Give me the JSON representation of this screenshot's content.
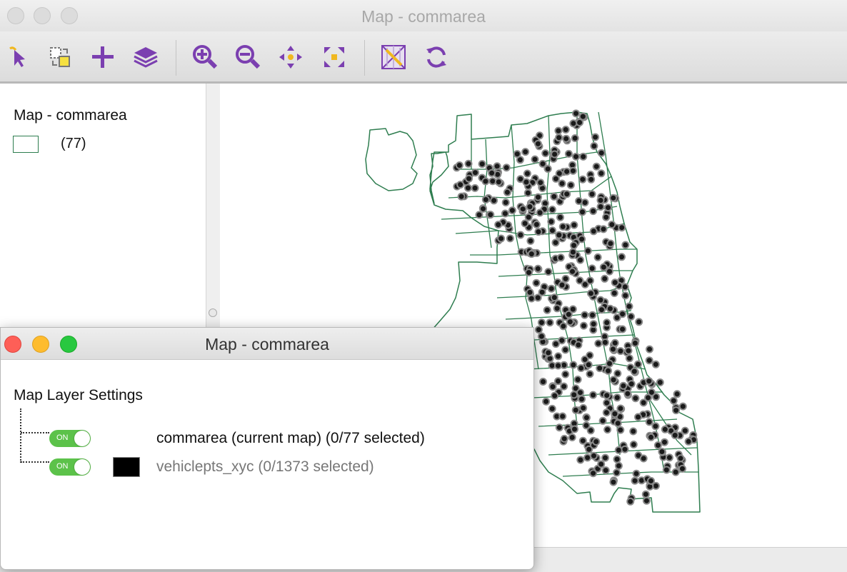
{
  "main_window": {
    "title": "Map - commarea"
  },
  "toolbar": {
    "buttons": [
      {
        "name": "select-tool",
        "icon": "cursor-icon"
      },
      {
        "name": "selection-settings",
        "icon": "select-shape-icon"
      },
      {
        "name": "add-layer",
        "icon": "plus-icon"
      },
      {
        "name": "layers",
        "icon": "layers-icon"
      },
      {
        "name": "zoom-in",
        "icon": "zoom-in-icon"
      },
      {
        "name": "zoom-out",
        "icon": "zoom-out-icon"
      },
      {
        "name": "pan",
        "icon": "pan-icon"
      },
      {
        "name": "full-extent",
        "icon": "extent-icon"
      },
      {
        "name": "basemap",
        "icon": "basemap-icon"
      },
      {
        "name": "refresh",
        "icon": "refresh-icon"
      }
    ],
    "accent_color": "#7b3fb0",
    "highlight_color": "#f0b820"
  },
  "legend": {
    "title": "Map - commarea",
    "count": "(77)",
    "swatch_border_color": "#2e7d4f"
  },
  "map": {
    "boundary_color": "#2e7d4f",
    "point_fill_color": "#1a1a1a",
    "point_outline_color": "#8a8a8a"
  },
  "settings_window": {
    "title": "Map - commarea",
    "heading": "Map Layer Settings",
    "layers": [
      {
        "name": "commarea (current map) (0/77 selected)",
        "toggle": "ON",
        "active": true
      },
      {
        "name": "vehiclepts_xyc (0/1373 selected)",
        "toggle": "ON",
        "active": false,
        "swatch_color": "#000000"
      }
    ]
  }
}
